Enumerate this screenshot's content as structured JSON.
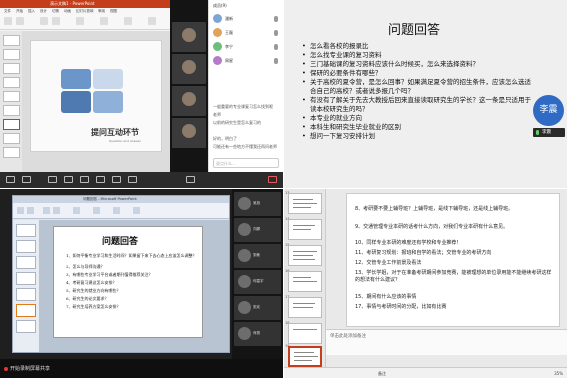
{
  "top_left": {
    "ppt_title": "演示文稿1 - PowerPoint",
    "ribbon_tabs": [
      "文件",
      "开始",
      "插入",
      "设计",
      "切换",
      "动画",
      "幻灯片放映",
      "审阅",
      "视图"
    ],
    "slide_title": "提问互动环节",
    "slide_subtitle": "Question and answer",
    "meeting_panel_title": "成员(9)",
    "members": [
      "潘新",
      "王磊",
      "李宁",
      "周星"
    ],
    "chat": [
      "一般重要的专业课复习怎么找到呢",
      "老师",
      "以前的研究生是怎么复习的",
      "好的，明白了",
      "可能还有一些地方不懂我还再问老师"
    ],
    "chat_placeholder": "说点什么..."
  },
  "top_right": {
    "title": "问题回答",
    "items": [
      "怎么看各校的报录比",
      "怎么找专业课的复习资料",
      "三门基础课的复习资料应该什么时候买，怎么来选择资料？",
      "保研的必要条件有哪些？",
      "关于高校的夏令营，是怎么回事？如果满足夏令营的招生条件，应该怎么选适合自己的高校？或者说多报几个吗？",
      "有没有了解关于先去大教授后回来直接读取研究生的学长？这一条是只适用于读本校研究生的吗？",
      "本专业的就业方向",
      "本科生和研究生毕业就业的区别",
      "想问一下复习安排计划"
    ],
    "avatar_name": "李震",
    "speaker_name": "李震"
  },
  "bottom_left": {
    "window_title": "问题回答 - Microsoft PowerPoint",
    "slide_title": "问题回答",
    "items": [
      "1、如何平衡专业学习和生活时间？如果留下来下去心态上应该怎么调整？",
      "2、怎么与导师沟通？",
      "3、有哪些专业学习平台或者期刊值得推荐关注？",
      "4、考研复习建议怎么安排？",
      "5、研究生的就业方向有哪些？",
      "6、研究生的论文要求？",
      "7、研究生培养方案怎么安排？"
    ],
    "participants": [
      "吴旭",
      "刘娜",
      "张敏",
      "何嘉宇",
      "张欢",
      "肖丽",
      "陈晨"
    ],
    "recording": "开始录制屏幕共享"
  },
  "bottom_right": {
    "items": [
      "8、考研要不要上辅导班？上辅导班，是线下辅导班，还是线上辅导班。",
      "9、交通管理专业本研的话考什么方向，对我们专业本研有什么意见。",
      "10、同样专业本研的难度还有学校和专业推荐！",
      "11、考研复习规划：报班和自学的看法；交管专业的考研方向",
      "12、交管专业工作前景及看法",
      "13、学长学姐，对于在准备考研期间参加竞赛，能被理想的单位录用能不能继续考研这样的想法有什么建议？",
      "15、期间有什么应该的事情",
      "17、事情与考研时间的分配，比如有比赛"
    ],
    "notes_placeholder": "单击此处添加备注",
    "status_notes": "备注",
    "zoom": "35%"
  }
}
